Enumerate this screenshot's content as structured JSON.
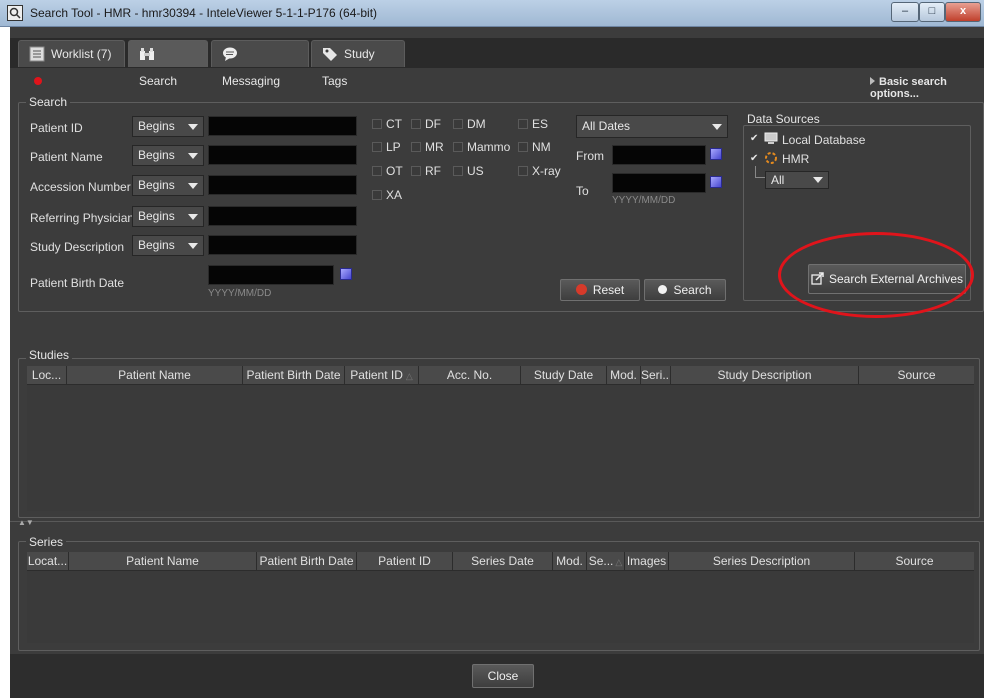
{
  "window": {
    "title": "Search Tool - HMR - hmr30394 - InteleViewer 5-1-1-P176 (64-bit)",
    "minimize": "–",
    "maximize": "□",
    "close": "x"
  },
  "tabs": [
    {
      "label": "Worklist (7)",
      "icon": "worklist-icon",
      "badge_color": "#e0141b"
    },
    {
      "label": "Search",
      "icon": "binoculars-icon"
    },
    {
      "label": "Messaging",
      "icon": "chat-icon"
    },
    {
      "label": "Study Tags",
      "icon": "tag-icon"
    }
  ],
  "basic_search_options": "Basic search options...",
  "search": {
    "group_label": "Search",
    "fields": [
      {
        "label": "Patient ID",
        "mode": "Begins",
        "value": ""
      },
      {
        "label": "Patient Name",
        "mode": "Begins",
        "value": ""
      },
      {
        "label": "Accession Number",
        "mode": "Begins",
        "value": ""
      },
      {
        "label": "Referring Physician",
        "mode": "Begins",
        "value": ""
      },
      {
        "label": "Study Description",
        "mode": "Begins",
        "value": ""
      }
    ],
    "birth_date": {
      "label": "Patient Birth Date",
      "hint": "YYYY/MM/DD",
      "value": ""
    },
    "modalities": [
      "CT",
      "DF",
      "DM",
      "ES",
      "LP",
      "MR",
      "Mammo",
      "NM",
      "OT",
      "RF",
      "US",
      "X-ray",
      "XA"
    ],
    "date_range": "All Dates",
    "from_label": "From",
    "to_label": "To",
    "date_hint": "YYYY/MM/DD",
    "reset_label": "Reset",
    "search_label": "Search"
  },
  "data_sources": {
    "group_label": "Data Sources",
    "items": [
      {
        "label": "Local Database",
        "checked": true,
        "icon": "computer-icon"
      },
      {
        "label": "HMR",
        "checked": true,
        "icon": "spinner-icon"
      }
    ],
    "filter": "All",
    "external_button": "Search External Archives"
  },
  "studies": {
    "group_label": "Studies",
    "columns": [
      "Loc...",
      "Patient Name",
      "Patient Birth Date",
      "Patient ID",
      "Acc. No.",
      "Study Date",
      "Mod.",
      "Seri...",
      "Study Description",
      "Source"
    ],
    "rows": []
  },
  "series": {
    "group_label": "Series",
    "columns": [
      "Locat...",
      "Patient Name",
      "Patient Birth Date",
      "Patient ID",
      "Series Date",
      "Mod.",
      "Se...",
      "Images",
      "Series Description",
      "Source"
    ],
    "rows": []
  },
  "close_label": "Close"
}
